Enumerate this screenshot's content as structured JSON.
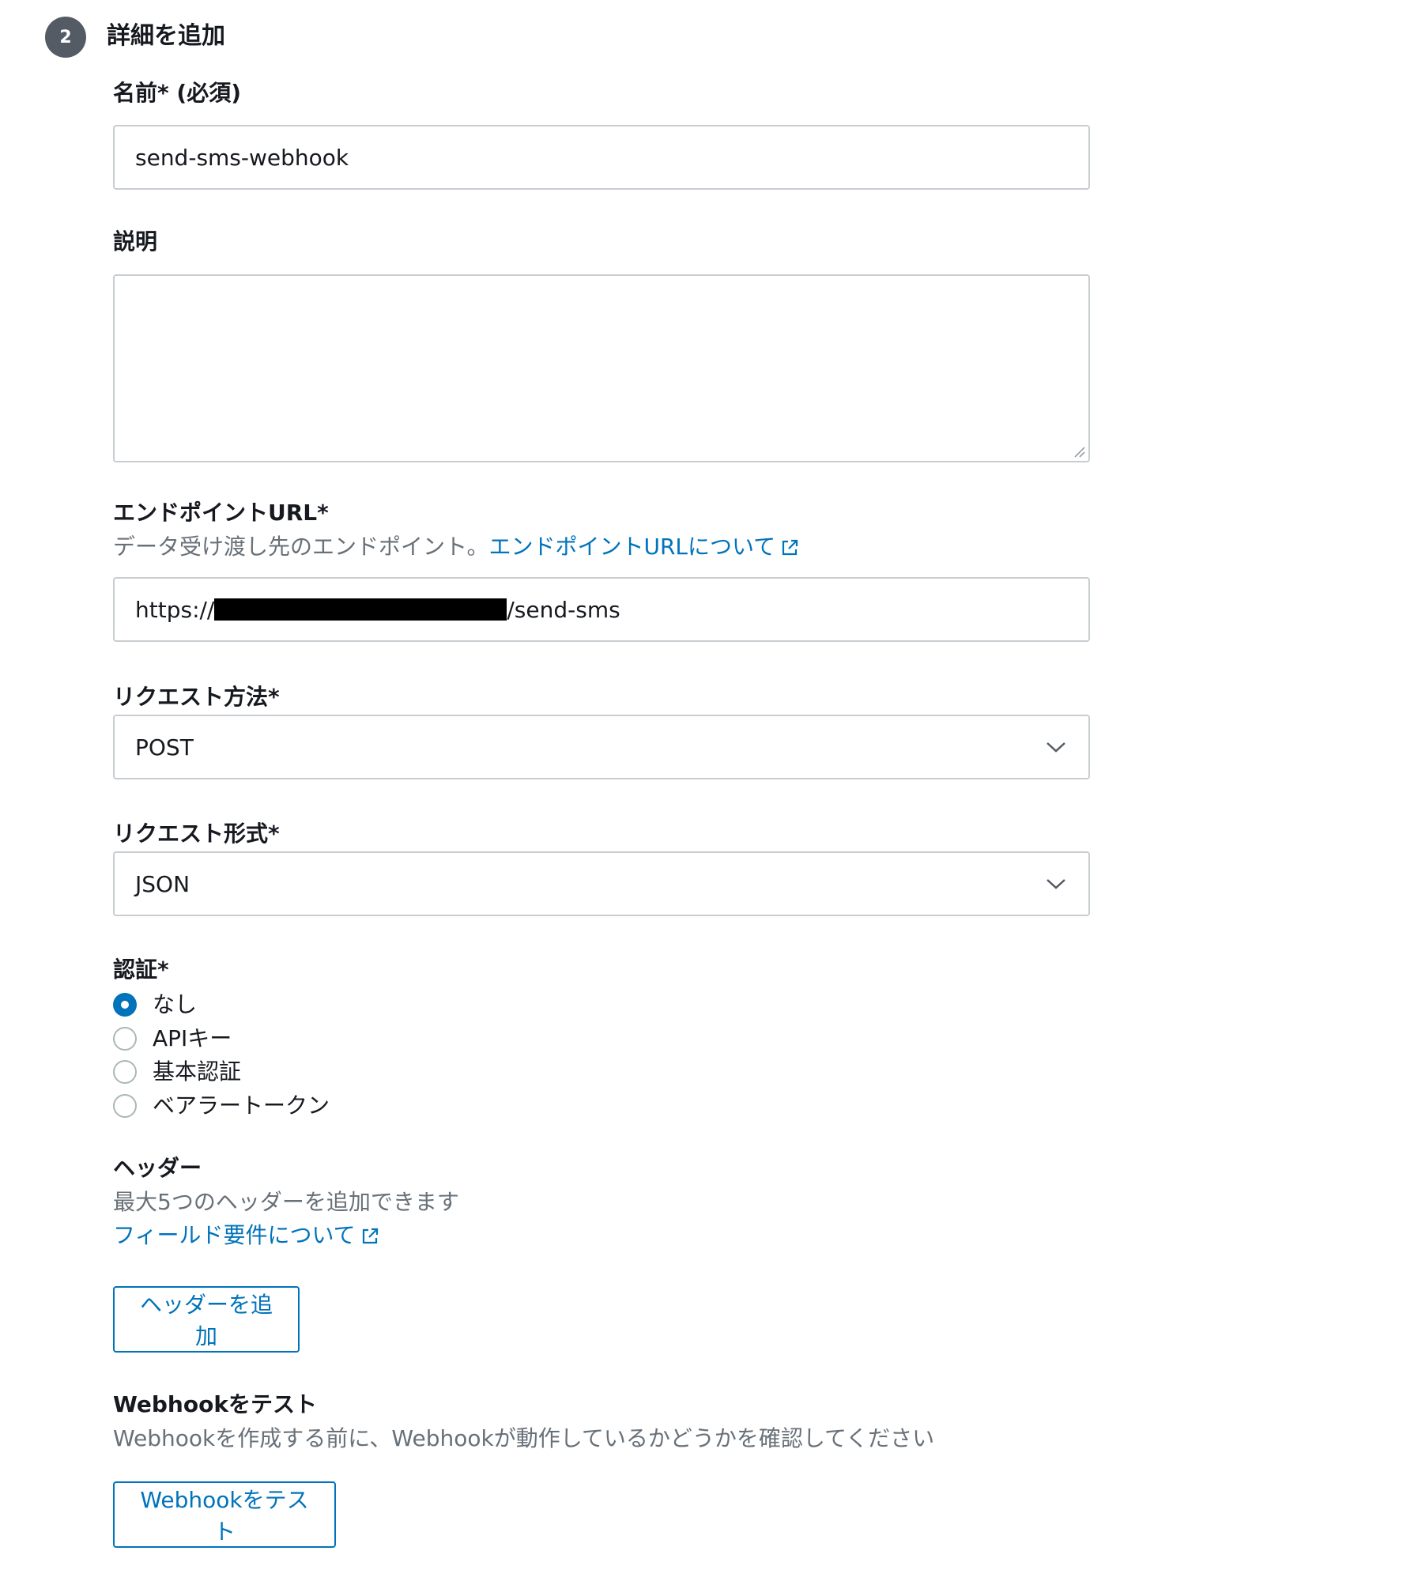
{
  "step": {
    "number": "2",
    "title": "詳細を追加"
  },
  "name_field": {
    "label": "名前* (必須)",
    "value": "send-sms-webhook"
  },
  "description_field": {
    "label": "説明",
    "value": ""
  },
  "endpoint_field": {
    "label": "エンドポイントURL*",
    "description": "データ受け渡し先のエンドポイント。",
    "link_text": "エンドポイントURLについて",
    "value_prefix": "https://",
    "value_suffix": "/send-sms"
  },
  "request_method": {
    "label": "リクエスト方法*",
    "selected": "POST"
  },
  "request_format": {
    "label": "リクエスト形式*",
    "selected": "JSON"
  },
  "auth": {
    "label": "認証*",
    "options": [
      "なし",
      "APIキー",
      "基本認証",
      "ベアラートークン"
    ],
    "selected": "なし"
  },
  "headers": {
    "label": "ヘッダー",
    "description": "最大5つのヘッダーを追加できます",
    "link_text": "フィールド要件について",
    "add_button": "ヘッダーを追加"
  },
  "test": {
    "label": "Webhookをテスト",
    "description": "Webhookを作成する前に、Webhookが動作しているかどうかを確認してください",
    "button": "Webhookをテスト"
  },
  "colors": {
    "accent": "#0073bb",
    "text": "#16191f",
    "secondary_text": "#687078",
    "border": "#c8cdd2"
  }
}
